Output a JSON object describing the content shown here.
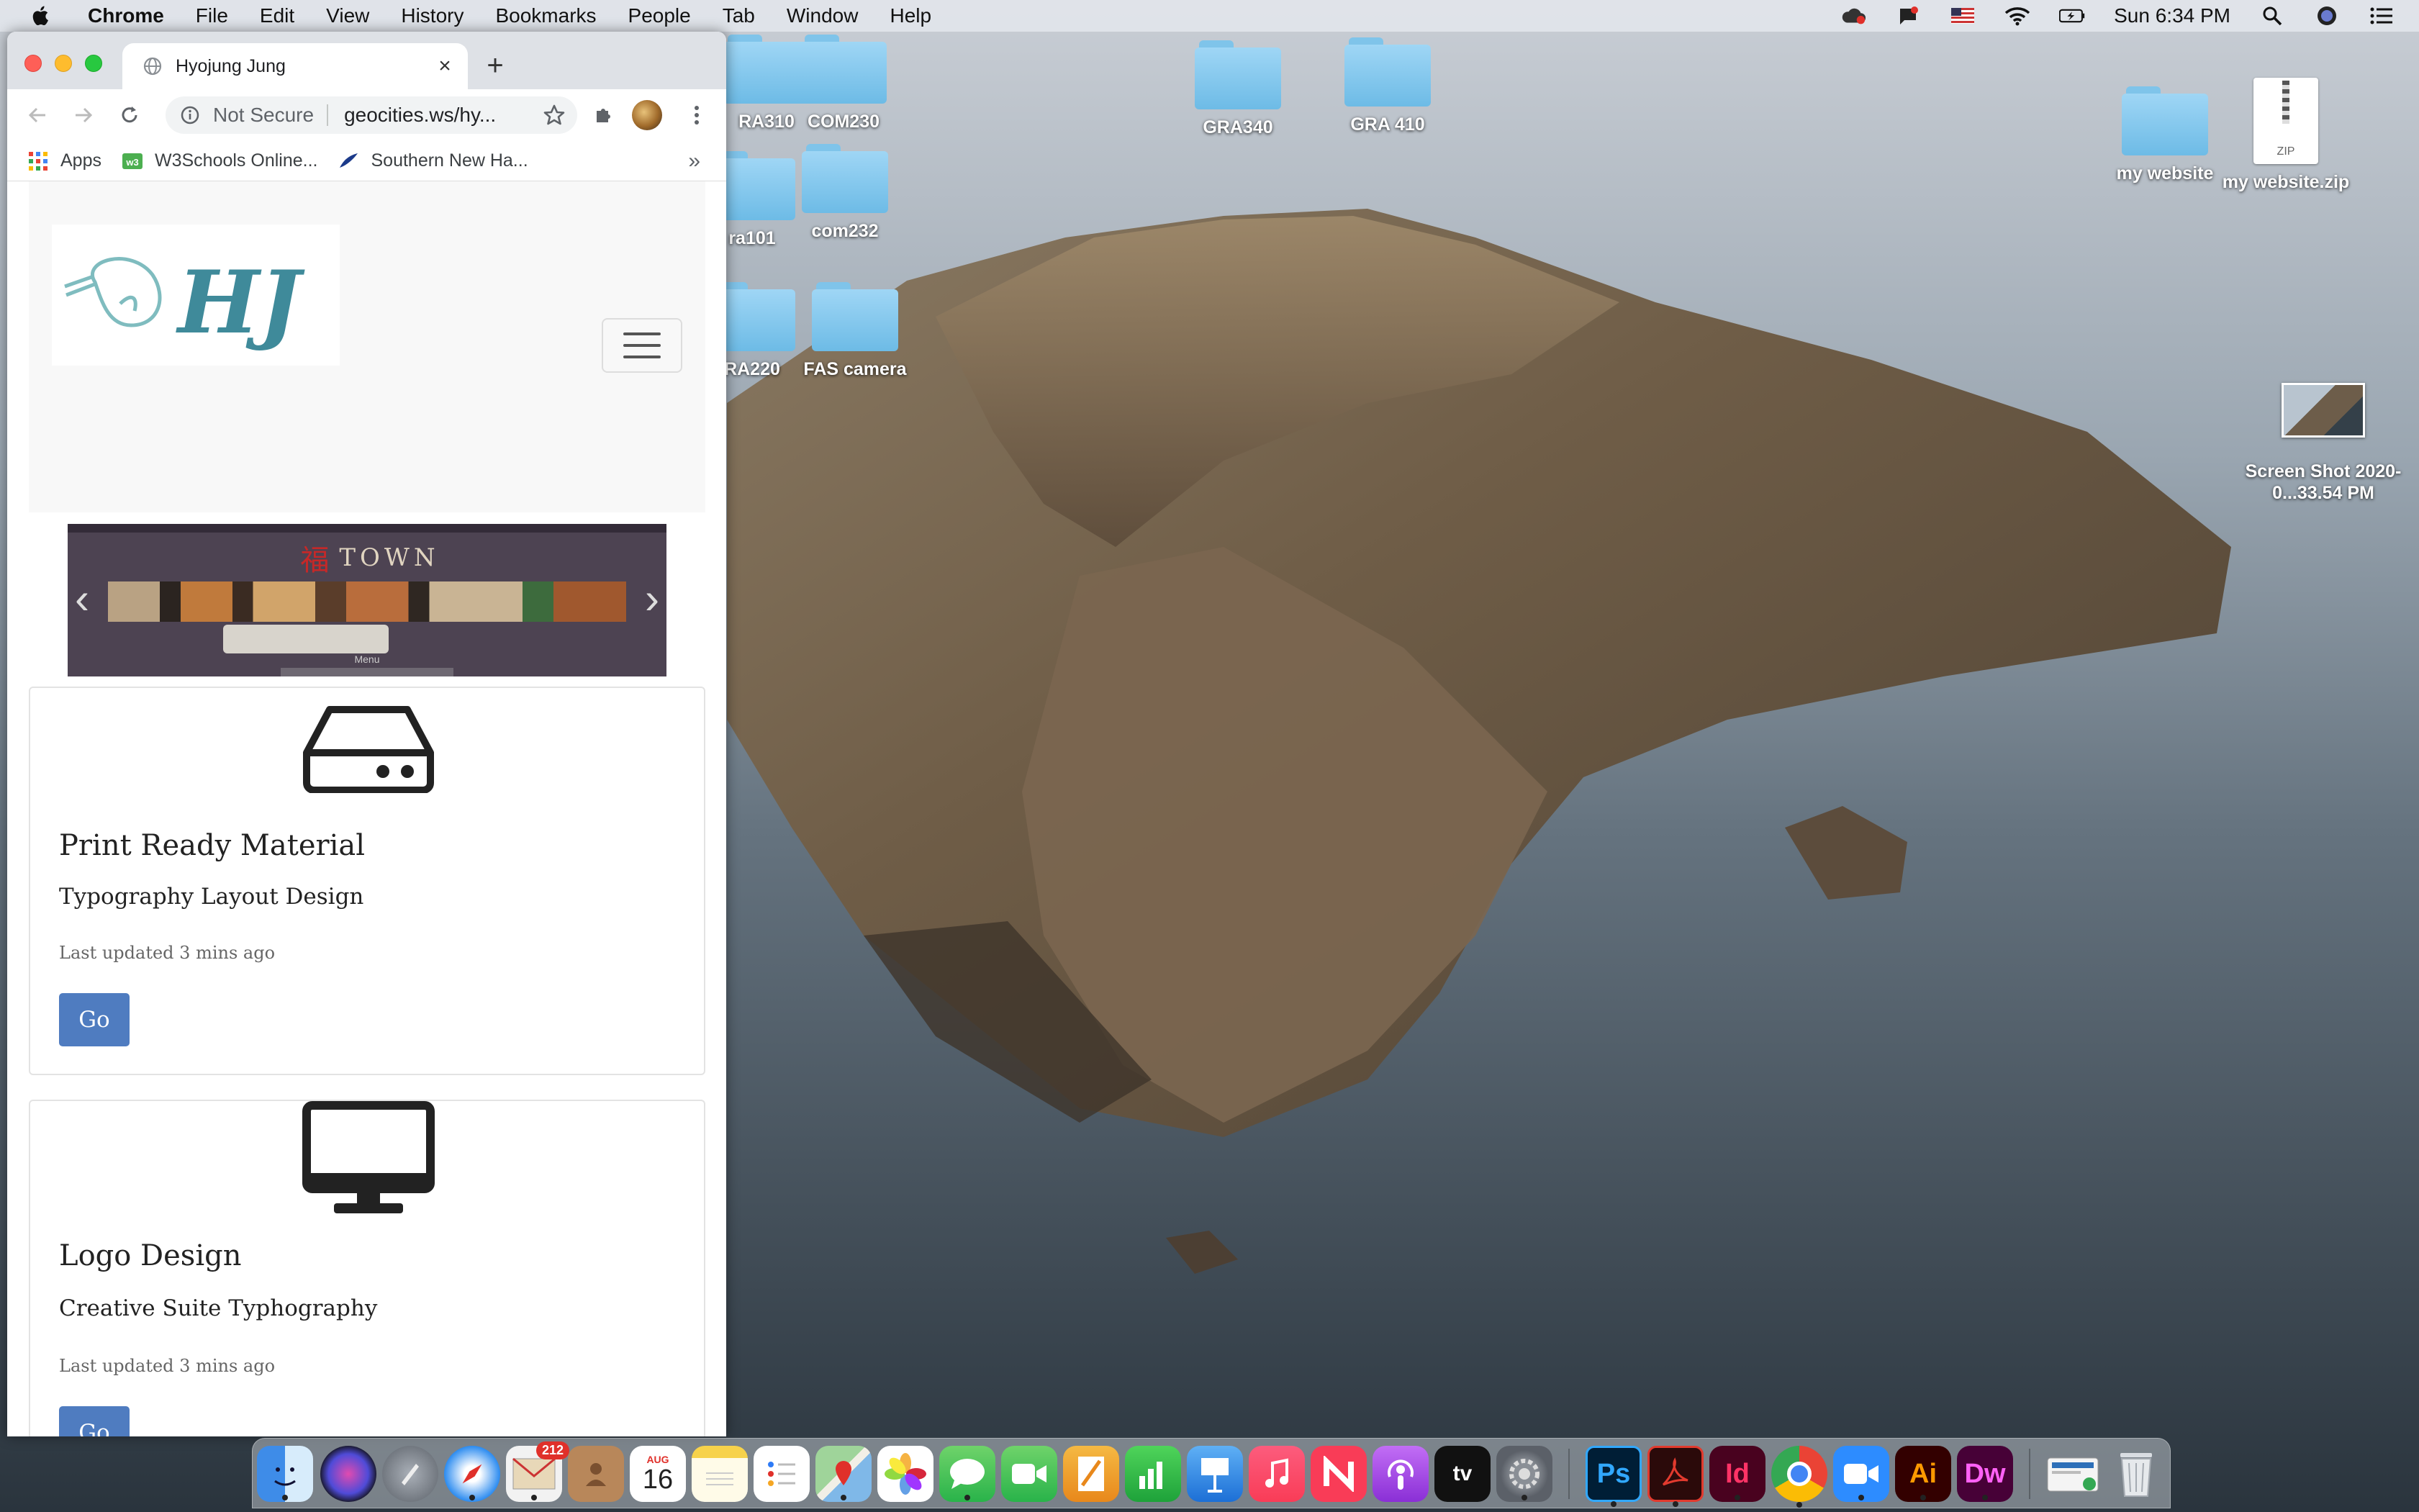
{
  "menubar": {
    "app": "Chrome",
    "menus": [
      "File",
      "Edit",
      "View",
      "History",
      "Bookmarks",
      "People",
      "Tab",
      "Window",
      "Help"
    ],
    "clock": "Sun 6:34 PM"
  },
  "desktop": {
    "icons": [
      {
        "label": "RA310",
        "type": "folder"
      },
      {
        "label": "COM230",
        "type": "folder"
      },
      {
        "label": "ra101",
        "type": "folder"
      },
      {
        "label": "com232",
        "type": "folder"
      },
      {
        "label": "RA220",
        "type": "folder"
      },
      {
        "label": "FAS camera",
        "type": "folder"
      },
      {
        "label": "GRA340",
        "type": "folder"
      },
      {
        "label": "GRA 410",
        "type": "folder"
      },
      {
        "label": "my website",
        "type": "folder"
      },
      {
        "label": "my website.zip",
        "type": "zip",
        "badge": "ZIP"
      },
      {
        "label": "Screen Shot 2020-0...33.54 PM",
        "type": "screenshot"
      }
    ]
  },
  "browser": {
    "tab_title": "Hyojung Jung",
    "security": "Not Secure",
    "url": "geocities.ws/hy...",
    "bookmarks": [
      "Apps",
      "W3Schools Online...",
      "Southern New Ha..."
    ],
    "more": "»"
  },
  "site": {
    "logo_text": "HJ",
    "carousel": {
      "slide_brand_symbol": "福",
      "slide_brand": "TOWN",
      "slide_caption": "Menu"
    },
    "cards": [
      {
        "icon": "hard-drive-icon",
        "title": "Print Ready Material",
        "subtitle": "Typography Layout Design",
        "meta": "Last updated 3 mins ago",
        "button": "Go"
      },
      {
        "icon": "desktop-monitor-icon",
        "title": "Logo Design",
        "subtitle": "Creative Suite Typhography",
        "meta": "Last updated 3 mins ago",
        "button": "Go"
      }
    ]
  },
  "dock": {
    "apps": [
      "Finder",
      "Siri",
      "Launchpad",
      "Safari",
      "Mail",
      "Contacts",
      "Calendar",
      "Notes",
      "Reminders",
      "Maps",
      "Photos",
      "Messages",
      "FaceTime",
      "Pages",
      "Numbers",
      "Keynote",
      "Music",
      "News",
      "Podcasts",
      "TV",
      "System Preferences",
      "Photoshop",
      "Acrobat",
      "InDesign",
      "Chrome",
      "Zoom",
      "Illustrator",
      "Dreamweaver",
      "Downloads",
      "Trash"
    ],
    "mail_badge": "212",
    "calendar_month": "AUG",
    "calendar_day": "16",
    "ps_label": "Ps",
    "id_label": "Id",
    "ai_label": "Ai",
    "dw_label": "Dw",
    "tv_label": "tv"
  },
  "colors": {
    "accent_button": "#4f7cc0",
    "folder_blue": "#6dbbe6",
    "chrome_frame": "#dee1e6"
  }
}
